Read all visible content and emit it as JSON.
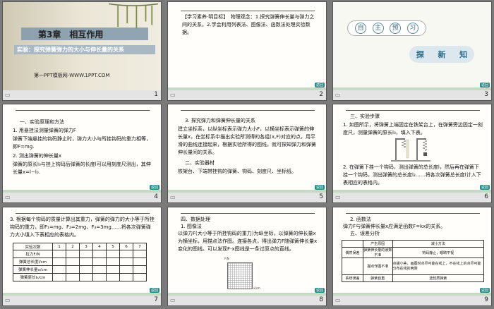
{
  "slides": [
    {
      "num": "1",
      "chapter": "第3章　相互作用",
      "subtitle": "实验：探究弹簧弹力的大小与伸长量的关系",
      "footer": "第一PPT模板网-WWW.1PPT.COM"
    },
    {
      "num": "2",
      "text": "【学习素养·明目标】　物理观念：1.探究弹簧伸长量与弹力之间的关系。2.学会利用列表法、图像法、函数法处理实验数据。"
    },
    {
      "num": "3",
      "pill": [
        "自",
        "主",
        "预",
        "习"
      ],
      "chip": [
        "探",
        "新",
        "知"
      ]
    },
    {
      "num": "4",
      "lines": [
        "一、实验原理和方法",
        "1. 用悬挂法测量弹簧的弹力F",
        "弹簧下端悬挂的钩码静止时，弹力大小与所挂钩码的重力相等，即F=mg.",
        "2. 测出弹簧的伸长量x",
        "弹簧的原长l₀与挂上钩码后弹簧的长度l可以用刻度尺测出，其伸长量x=l−l₀."
      ]
    },
    {
      "num": "5",
      "lines": [
        "3. 探究弹力和弹簧伸长量的关系",
        "建立坐标系，以纵坐标表示弹力大小F，以横坐标表示弹簧的伸长量x，在坐标系中描出实验所测得的各组(x,F)对应的点，用平滑的曲线连接起来，根据实验所得的图线，就可探知弹力和弹簧伸长量间的关系。",
        "二、实验器材",
        "铁架台、下端带挂钩的弹簧、钩码、刻度尺、坐标纸。"
      ]
    },
    {
      "num": "6",
      "lines": [
        "三、实验步骤",
        "1. 如图所示，将弹簧上端固定在铁架台上，在弹簧旁边固定一刻度尺，测量弹簧的原长l₀，填入下表。",
        "2. 在弹簧下挂一个钩码，测出弹簧的总长度l，然后再在弹簧下挂一个钩码，测出弹簧的总长度l₂……将各次弹簧总长度l计入下表相应的表格内。"
      ]
    },
    {
      "num": "7",
      "lines": [
        "3. 根据每个钩码的质量计算出其重力，弹簧的弹力的大小等于所挂钩码的重力，即F₁=mg、F₂=2mg、F₃=3mg……将各次弹簧弹力大小填入下表相应的表格内。"
      ],
      "table_header": [
        "实验次数",
        "1",
        "2",
        "3",
        "4",
        "5",
        "6",
        "7"
      ],
      "table_rows": [
        "拉力F/N",
        "弹簧总长度l/cm",
        "弹簧伸长量x/cm",
        "弹簧原长l₀/cm"
      ]
    },
    {
      "num": "8",
      "lines": [
        "四、数据处理",
        "1. 图像法",
        "以弹力F(大小等于所挂钩码的重力)为纵坐标，以弹簧的伸长量x为横坐标，用描点法作图。连接各点，得出弹力F随弹簧伸长量x变化的图线。可以发现F-x图线是一条过原点的直线。"
      ],
      "axis_y": "F/N",
      "axis_x": "x/cm"
    },
    {
      "num": "9",
      "lines": [
        "2. 函数法",
        "弹力F与弹簧伸长量x应满足函数F=kx的关系。",
        "五、误差分析"
      ],
      "table_header": [
        "",
        "产生原因",
        "减小方法"
      ],
      "table_rows": [
        [
          "偶然误差",
          "弹簧伸长量的读数不准",
          "钩码静止，眼睛平视"
        ],
        [
          "",
          "描点作图不准",
          "点描小些，画图时点尽可能在线上，不在线上的点尽可能分布在线的两侧"
        ],
        [
          "系统误差",
          "弹簧自重",
          "选轻质弹簧"
        ]
      ]
    }
  ]
}
